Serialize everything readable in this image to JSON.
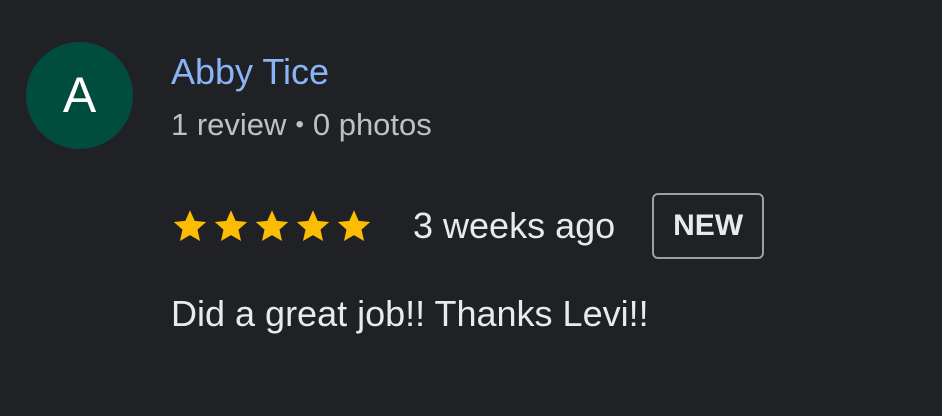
{
  "reviewer": {
    "initial": "A",
    "avatar_color": "#004d40",
    "name": "Abby Tice",
    "name_color": "#8ab4f8",
    "review_count": "1 review",
    "separator": "•",
    "photo_count": "0 photos"
  },
  "rating": {
    "stars": 5,
    "max_stars": 5,
    "star_color": "#fbbc04",
    "icon": "star-icon"
  },
  "review": {
    "time_ago": "3 weeks ago",
    "badge": "NEW",
    "text": "Did a great job!! Thanks Levi!!"
  }
}
